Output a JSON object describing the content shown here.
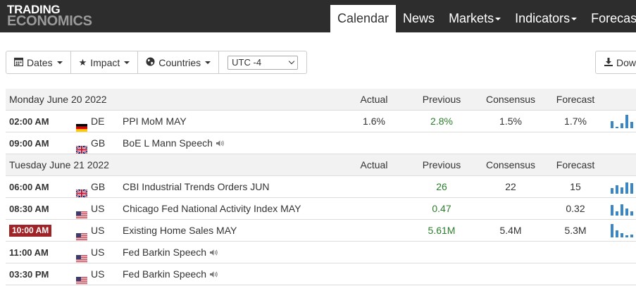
{
  "logo": {
    "line1": "TRADING",
    "line2": "ECONOMICS"
  },
  "nav": {
    "items": [
      {
        "label": "Calendar",
        "active": true,
        "dropdown": false
      },
      {
        "label": "News",
        "active": false,
        "dropdown": false
      },
      {
        "label": "Markets",
        "active": false,
        "dropdown": true
      },
      {
        "label": "Indicators",
        "active": false,
        "dropdown": true
      },
      {
        "label": "Forecast",
        "active": false,
        "dropdown": false
      }
    ]
  },
  "toolbar": {
    "dates_label": "Dates",
    "impact_label": "Impact",
    "countries_label": "Countries",
    "timezone_value": "UTC -4",
    "download_label": "Download"
  },
  "columns": {
    "actual": "Actual",
    "previous": "Previous",
    "consensus": "Consensus",
    "forecast": "Forecast"
  },
  "days": [
    {
      "date": "Monday June 20 2022",
      "events": [
        {
          "time": "02:00 AM",
          "country": "DE",
          "flag": "de",
          "event": "PPI MoM MAY",
          "actual": "1.6%",
          "previous": "2.8%",
          "previous_color": "green",
          "consensus": "1.5%",
          "forecast": "1.7%",
          "speech": false,
          "highlight": false,
          "spark": [
            0.55,
            0.1,
            0.35,
            1.0,
            0.45
          ]
        },
        {
          "time": "09:00 AM",
          "country": "GB",
          "flag": "gb",
          "event": "BoE L Mann Speech",
          "actual": "",
          "previous": "",
          "previous_color": "",
          "consensus": "",
          "forecast": "",
          "speech": true,
          "highlight": false,
          "spark": []
        }
      ]
    },
    {
      "date": "Tuesday June 21 2022",
      "events": [
        {
          "time": "06:00 AM",
          "country": "GB",
          "flag": "gb",
          "event": "CBI Industrial Trends Orders JUN",
          "actual": "",
          "previous": "26",
          "previous_color": "green",
          "consensus": "22",
          "forecast": "15",
          "speech": false,
          "highlight": false,
          "spark": [
            0.4,
            0.65,
            0.45,
            0.85,
            0.8
          ]
        },
        {
          "time": "08:30 AM",
          "country": "US",
          "flag": "us",
          "event": "Chicago Fed National Activity Index MAY",
          "actual": "",
          "previous": "0.47",
          "previous_color": "green",
          "consensus": "",
          "forecast": "0.32",
          "speech": false,
          "highlight": false,
          "spark": [
            0.8,
            0.3,
            0.85,
            0.55,
            0.3
          ]
        },
        {
          "time": "10:00 AM",
          "country": "US",
          "flag": "us",
          "event": "Existing Home Sales MAY",
          "actual": "",
          "previous": "5.61M",
          "previous_color": "green",
          "consensus": "5.4M",
          "forecast": "5.3M",
          "speech": false,
          "highlight": true,
          "spark": [
            1.0,
            0.55,
            0.3,
            0.15,
            0.2
          ]
        },
        {
          "time": "11:00 AM",
          "country": "US",
          "flag": "us",
          "event": "Fed Barkin Speech",
          "actual": "",
          "previous": "",
          "previous_color": "",
          "consensus": "",
          "forecast": "",
          "speech": true,
          "highlight": false,
          "spark": []
        },
        {
          "time": "03:30 PM",
          "country": "US",
          "flag": "us",
          "event": "Fed Barkin Speech",
          "actual": "",
          "previous": "",
          "previous_color": "",
          "consensus": "",
          "forecast": "",
          "speech": true,
          "highlight": false,
          "spark": []
        }
      ]
    }
  ],
  "colors": {
    "topbar": "#2d2d2d",
    "highlight": "#a02327",
    "previous_green": "#2d7d2d",
    "spark": "#3a87c4",
    "header_row": "#f2f2f2"
  }
}
